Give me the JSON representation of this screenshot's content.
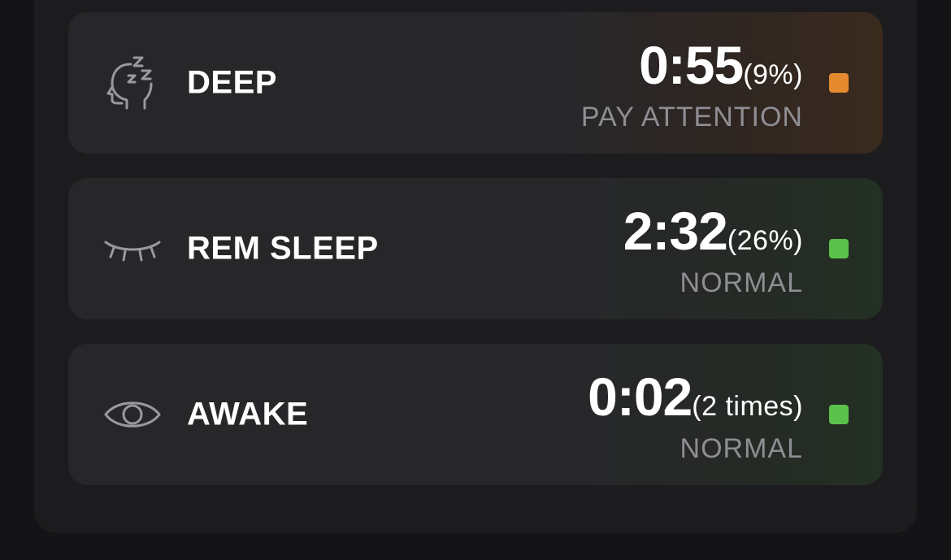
{
  "rows": [
    {
      "label": "DEEP",
      "duration": "0:55",
      "detail": "(9%)",
      "status": "PAY ATTENTION",
      "icon": "head-zzz-icon",
      "indicator_color": "#e58a2e"
    },
    {
      "label": "REM SLEEP",
      "duration": "2:32",
      "detail": "(26%)",
      "status": "NORMAL",
      "icon": "closed-eye-icon",
      "indicator_color": "#5ac14a"
    },
    {
      "label": "AWAKE",
      "duration": "0:02",
      "detail": "(2 times)",
      "status": "NORMAL",
      "icon": "open-eye-icon",
      "indicator_color": "#5ac14a"
    }
  ]
}
